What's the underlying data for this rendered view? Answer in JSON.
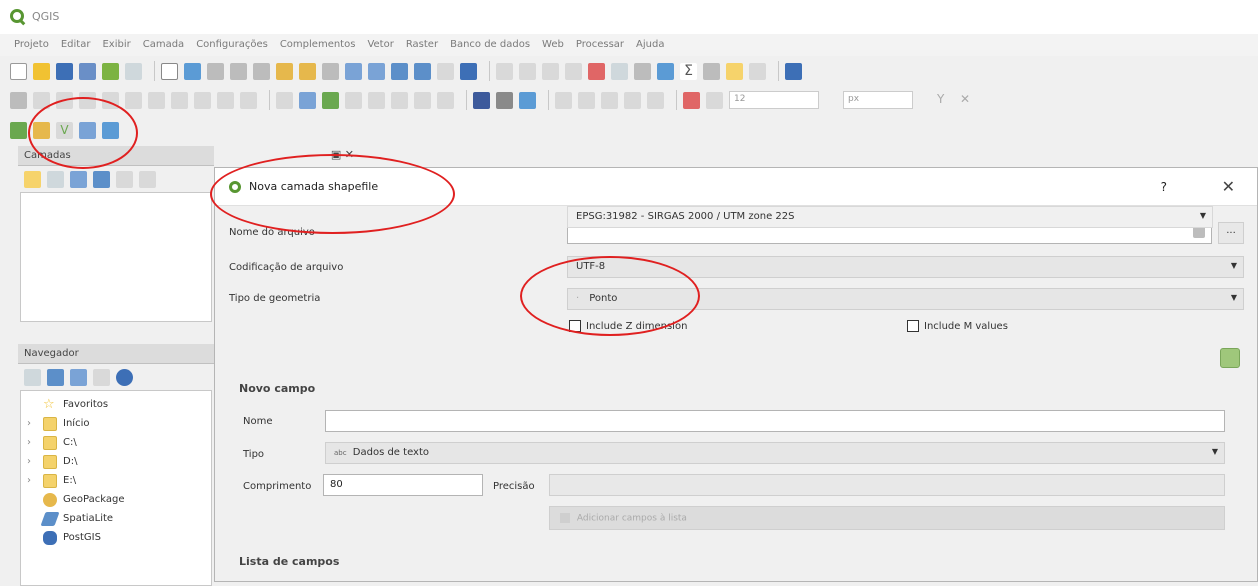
{
  "window": {
    "title": "QGIS"
  },
  "menu": [
    "Projeto",
    "Editar",
    "Exibir",
    "Camada",
    "Configurações",
    "Complementos",
    "Vetor",
    "Raster",
    "Banco de dados",
    "Web",
    "Processar",
    "Ajuda"
  ],
  "toolbar": {
    "font_size": "12",
    "font_unit": "px"
  },
  "layers_panel": {
    "title": "Camadas"
  },
  "browser_panel": {
    "title": "Navegador",
    "items": [
      {
        "label": "Favoritos",
        "icon": "star-icon",
        "expandable": false
      },
      {
        "label": "Início",
        "icon": "folder-icon",
        "expandable": true
      },
      {
        "label": "C:\\",
        "icon": "folder-icon",
        "expandable": true
      },
      {
        "label": "D:\\",
        "icon": "folder-icon",
        "expandable": true
      },
      {
        "label": "E:\\",
        "icon": "folder-icon",
        "expandable": true
      },
      {
        "label": "GeoPackage",
        "icon": "geopackage-icon",
        "expandable": false
      },
      {
        "label": "SpatiaLite",
        "icon": "feather-icon",
        "expandable": false
      },
      {
        "label": "PostGIS",
        "icon": "elephant-icon",
        "expandable": false
      }
    ]
  },
  "dialog": {
    "title": "Nova camada shapefile",
    "help": "?",
    "close": "✕",
    "file_name_label": "Nome do arquivo",
    "file_name_value": "",
    "browse_label": "...",
    "encoding_label": "Codificação de arquivo",
    "encoding_value": "UTF-8",
    "geometry_label": "Tipo de geometria",
    "geometry_value": "Ponto",
    "include_z_label": "Include Z dimension",
    "include_m_label": "Include M values",
    "crs_value": "EPSG:31982 - SIRGAS 2000 / UTM zone 22S",
    "new_field_section": "Novo campo",
    "name_label": "Nome",
    "name_value": "",
    "type_label": "Tipo",
    "type_prefix": "abc",
    "type_value": "Dados de texto",
    "length_label": "Comprimento",
    "length_value": "80",
    "precision_label": "Precisão",
    "precision_value": "",
    "add_button": "Adicionar campos à lista",
    "field_list_section": "Lista de campos"
  },
  "colors": {
    "qgis_green": "#589632",
    "annotation_red": "#e02020"
  }
}
